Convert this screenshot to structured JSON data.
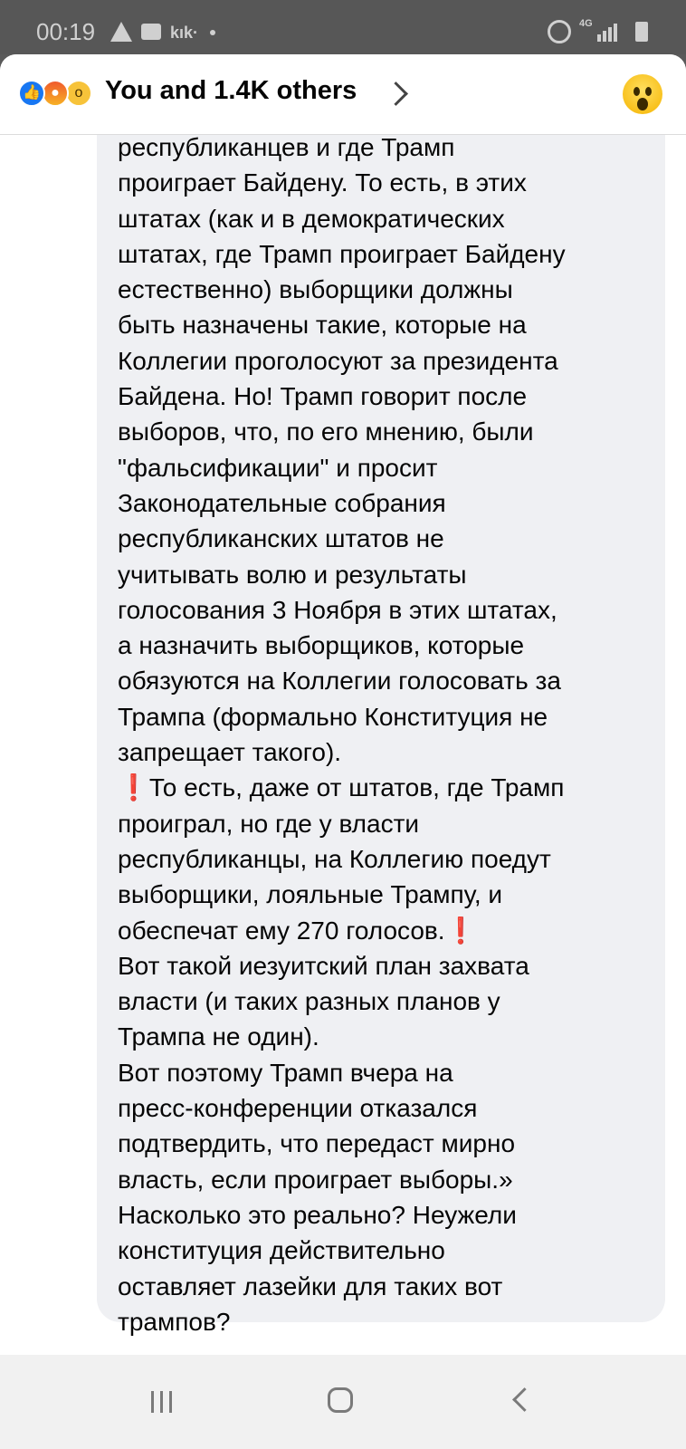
{
  "status_bar": {
    "time": "00:19",
    "app_label": "kık·",
    "network": "4G",
    "icons": [
      "warning-icon",
      "chat-icon",
      "kik-icon",
      "alarm-icon",
      "signal-icon",
      "battery-icon"
    ]
  },
  "reactions": {
    "summary": "You and 1.4K others",
    "icons": [
      "like-icon",
      "angry-icon",
      "wow-icon"
    ],
    "selected_reaction_icon": "wow-icon"
  },
  "comment": {
    "lines": [
      "республиканцев и где Трамп",
      "проиграет Байдену. То есть, в этих",
      "штатах (как и в демократических",
      "штатах, где Трамп проиграет Байдену",
      "естественно) выборщики должны",
      "быть назначены такие, которые на",
      "Коллегии проголосуют за президента",
      "Байдена. Но! Трамп говорит после",
      "выборов, что, по его мнению, были",
      "\"фальсификации\" и просит",
      "Законодательные собрания",
      "республиканских штатов не",
      "учитывать волю и результаты",
      "голосования 3 Ноября в этих штатах,",
      "а назначить выборщиков, которые",
      "обязуются на Коллегии голосовать за",
      "Трампа (формально Конституция не",
      "запрещает такого).",
      "❗То есть, даже от штатов, где Трамп",
      "проиграл, но где у власти",
      "республиканцы, на Коллегию поедут",
      "выборщики, лояльные Трампу, и",
      "обеспечат ему 270 голосов.❗",
      "Вот такой иезуитский план захвата",
      "власти (и таких разных планов у",
      "Трампа не один).",
      "Вот поэтому Трамп вчера на",
      "пресс-конференции отказался",
      "подтвердить, что передаст мирно",
      "власть, если проиграет выборы.»",
      "Насколько это  реально?  Неужели",
      "конституция  действительно",
      "оставляет  лазейки  для  таких  вот",
      "трампов?"
    ]
  },
  "nav_bar": {
    "icons": [
      "recents-icon",
      "home-icon",
      "back-icon"
    ]
  },
  "colors": {
    "like": "#1877f2",
    "bubble": "#eff0f3",
    "exclamation": "#e0202a"
  }
}
